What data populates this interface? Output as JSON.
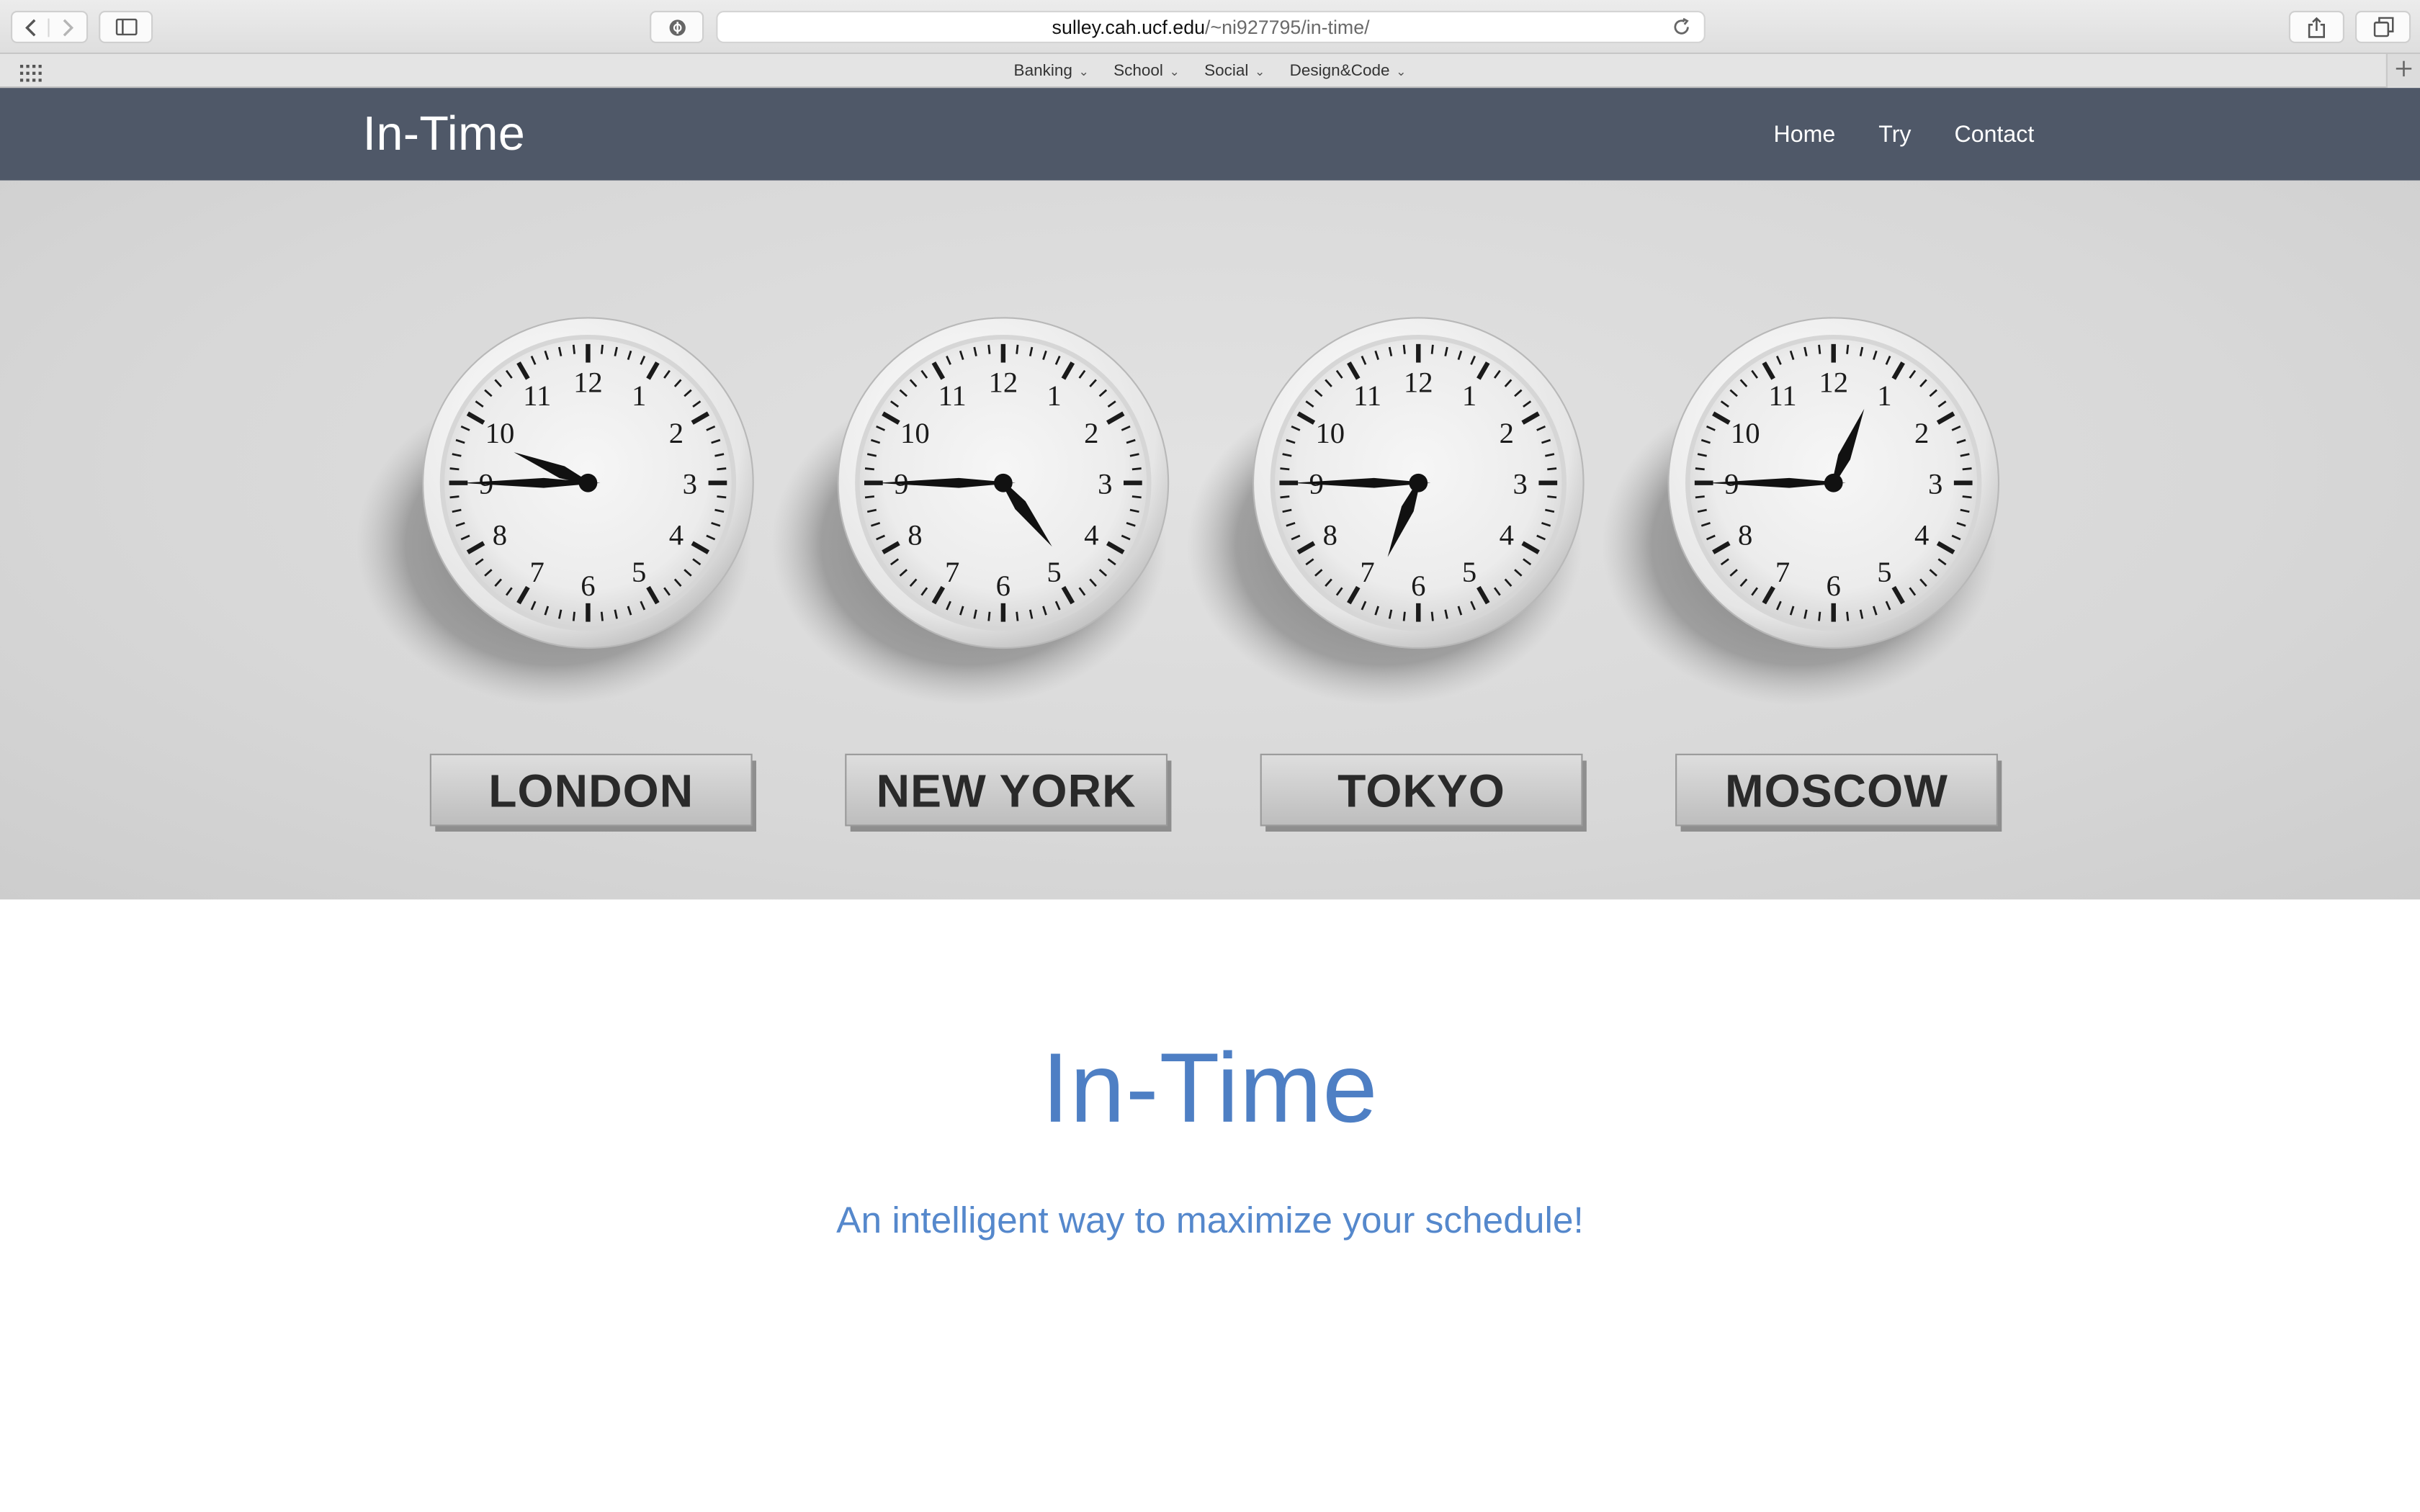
{
  "browser": {
    "url_host": "sulley.cah.ucf.edu",
    "url_path": "/~ni927795/in-time/",
    "bookmarks": [
      {
        "label": "Banking"
      },
      {
        "label": "School"
      },
      {
        "label": "Social"
      },
      {
        "label": "Design&Code"
      }
    ]
  },
  "navbar": {
    "brand": "In-Time",
    "links": [
      "Home",
      "Try",
      "Contact"
    ],
    "background": "#4f5868"
  },
  "hero": {
    "clocks": [
      {
        "city": "LONDON",
        "time": "9:45"
      },
      {
        "city": "NEW YORK",
        "time": "4:45"
      },
      {
        "city": "TOKYO",
        "time": "6:45"
      },
      {
        "city": "MOSCOW",
        "time": "12:45"
      }
    ]
  },
  "content": {
    "title": "In-Time",
    "subtitle": "An intelligent way to maximize your schedule!",
    "accent": "#4e7fc4"
  }
}
